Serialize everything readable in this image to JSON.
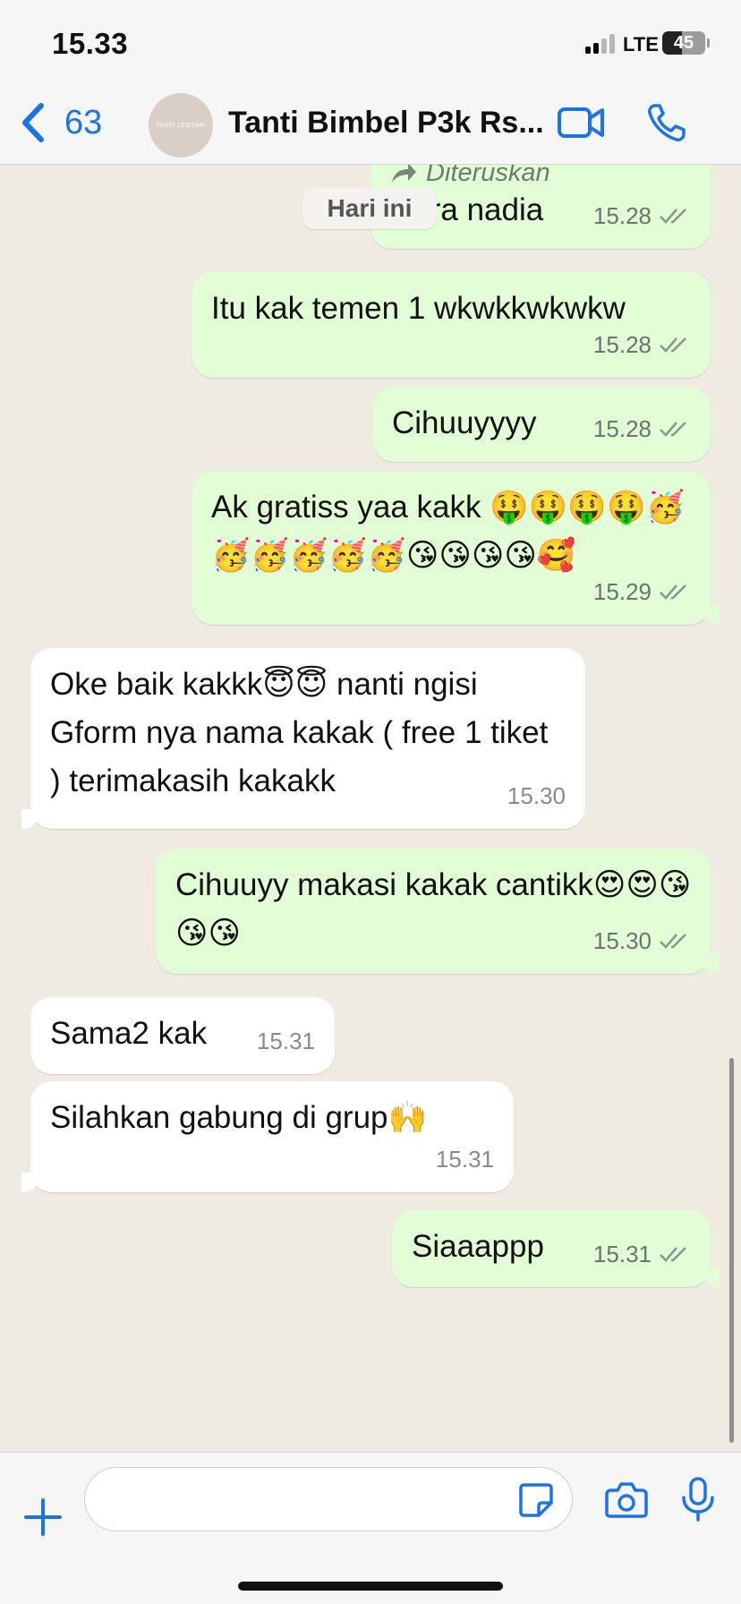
{
  "status_bar": {
    "time": "15.33",
    "network": "LTE",
    "battery": "45",
    "battery_level": 0.45
  },
  "header": {
    "back_count": "63",
    "chat_title": "Tanti Bimbel P3k Rs...",
    "avatar_text": "TANTI LESTARI",
    "icons": [
      "chevron-left-icon",
      "video-call-icon",
      "phone-call-icon"
    ]
  },
  "chat": {
    "date_chip": "Hari ini",
    "messages": [
      {
        "dir": "out",
        "forwarded_label": "Diteruskan",
        "text": "Dera nadia",
        "time": "15.28",
        "read": true
      },
      {
        "dir": "out",
        "text": "Itu kak temen 1 wkwkkwkwkw",
        "time": "15.28",
        "read": true
      },
      {
        "dir": "out",
        "text": "Cihuuyyyy",
        "time": "15.28",
        "read": true
      },
      {
        "dir": "out",
        "text": "Ak gratiss yaa kakk 🤑🤑🤑🤑🥳🥳🥳🥳🥳🥳😘😘😘😘🥰",
        "time": "15.29",
        "read": true
      },
      {
        "dir": "in",
        "text": "Oke baik kakkk😇😇 nanti ngisi Gform nya nama kakak ( free 1 tiket ) terimakasih kakakk",
        "time": "15.30"
      },
      {
        "dir": "out",
        "text": "Cihuuyy makasi kakak cantikk😍😍😘😘😘",
        "time": "15.30",
        "read": true
      },
      {
        "dir": "in",
        "text": "Sama2 kak",
        "time": "15.31"
      },
      {
        "dir": "in",
        "text": "Silahkan gabung di grup🙌",
        "time": "15.31"
      },
      {
        "dir": "out",
        "text": "Siaaappp",
        "time": "15.31",
        "read": true
      }
    ]
  },
  "input_bar": {
    "placeholder": "",
    "icons": [
      "plus-icon",
      "sticker-icon",
      "camera-icon",
      "microphone-icon"
    ]
  },
  "colors": {
    "outgoing_bubble": "#e2fcd5",
    "incoming_bubble": "#ffffff",
    "accent": "#1a73e8",
    "background": "#efeae2"
  }
}
